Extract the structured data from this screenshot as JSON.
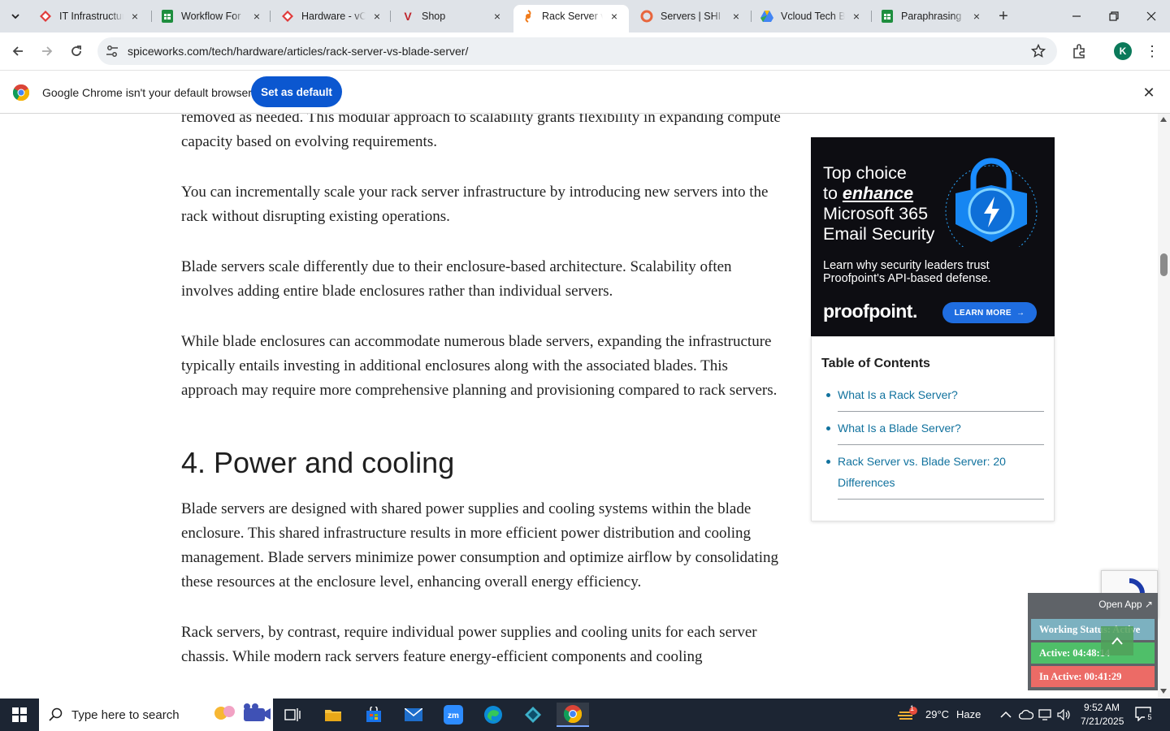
{
  "browser": {
    "tabs": [
      {
        "title": "IT Infrastructure",
        "favicon": "red-diamond"
      },
      {
        "title": "Workflow For",
        "favicon": "green-sheet"
      },
      {
        "title": "Hardware - vC",
        "favicon": "red-diamond"
      },
      {
        "title": "Shop",
        "favicon": "v-logo"
      },
      {
        "title": "Rack Server vs",
        "favicon": "spiceworks-swirl",
        "active": true
      },
      {
        "title": "Servers | SHI",
        "favicon": "shi-ring"
      },
      {
        "title": "Vcloud Tech B",
        "favicon": "drive-triangle"
      },
      {
        "title": "Paraphrasing",
        "favicon": "green-sheet"
      }
    ],
    "url": "spiceworks.com/tech/hardware/articles/rack-server-vs-blade-server/",
    "profile_initial": "K",
    "infobar": {
      "message": "Google Chrome isn't your default browser",
      "button": "Set as default"
    }
  },
  "article": {
    "paragraphs_before": [
      "removed as needed. This modular approach to scalability grants flexibility in expanding compute capacity based on evolving requirements.",
      "You can incrementally scale your rack server infrastructure by introducing new servers into the rack without disrupting existing operations.",
      "Blade servers scale differently due to their enclosure-based architecture. Scalability often involves adding entire blade enclosures rather than individual servers.",
      "While blade enclosures can accommodate numerous blade servers, expanding the infrastructure typically entails investing in additional enclosures along with the associated blades. This approach may require more comprehensive planning and provisioning compared to rack servers."
    ],
    "heading": "4. Power and cooling",
    "paragraphs_after": [
      "Blade servers are designed with shared power supplies and cooling systems within the blade enclosure. This shared infrastructure results in more efficient power distribution and cooling management. Blade servers minimize power consumption and optimize airflow by consolidating these resources at the enclosure level, enhancing overall energy efficiency.",
      "Rack servers, by contrast, require individual power supplies and cooling units for each server chassis. While modern rack servers feature energy-efficient components and cooling"
    ]
  },
  "ad": {
    "line1": "Top choice",
    "line2_prefix": "to ",
    "line2_emph": "enhance",
    "line3": "Microsoft 365",
    "line4": "Email Security",
    "sub": "Learn why security leaders trust Proofpoint's API-based defense.",
    "brand": "proofpoint.",
    "cta": "LEARN MORE"
  },
  "toc": {
    "title": "Table of Contents",
    "items": [
      "What Is a Rack Server?",
      "What Is a Blade Server?",
      "Rack Server vs. Blade Server: 20 Differences"
    ]
  },
  "widget": {
    "open_app": "Open App ↗",
    "status": "Working Status: Active",
    "active": "Active: 04:48:14",
    "inactive": "In Active: 00:41:29"
  },
  "taskbar": {
    "search_placeholder": "Type here to search",
    "weather_temp": "29°C",
    "weather_desc": "Haze",
    "weather_badge": "1",
    "time": "9:52 AM",
    "date": "7/21/2025",
    "notification_count": "5"
  },
  "colors": {
    "link": "#11729e",
    "chrome_blue": "#0b57d0",
    "ad_bg": "#0d0d12",
    "taskbar_bg": "#1c2533"
  }
}
